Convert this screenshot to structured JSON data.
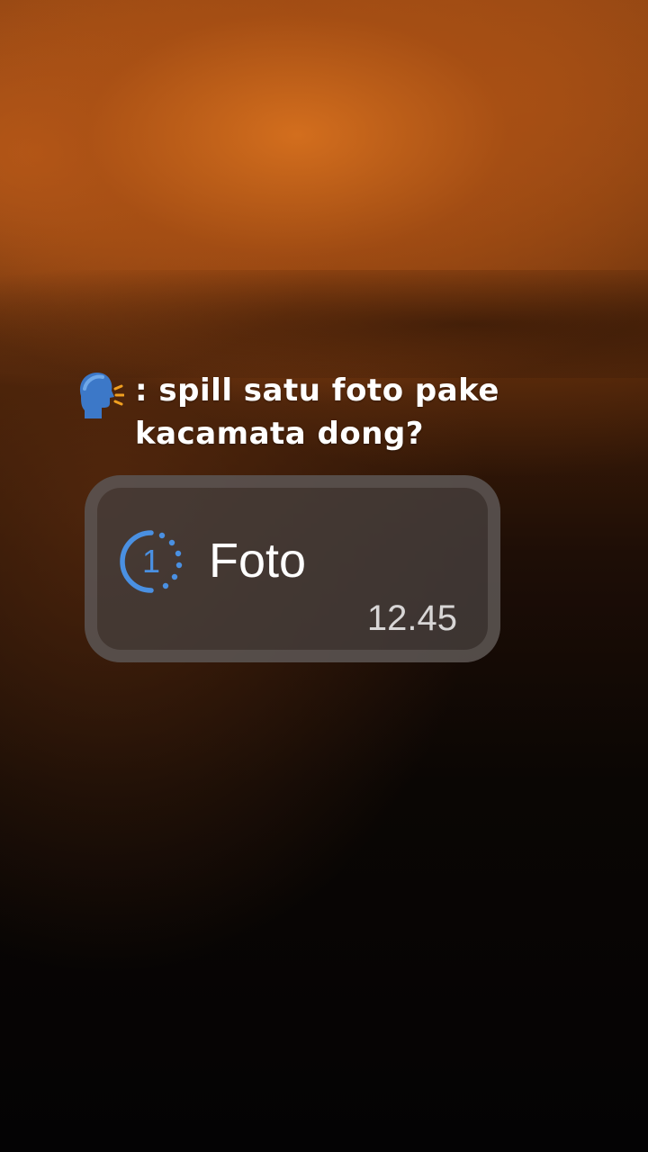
{
  "caption": {
    "speaker_icon": "speaking-head-icon",
    "text": ": spill satu foto pake\nkacamata dong?"
  },
  "message": {
    "icon": "view-once-icon",
    "view_once_count": "1",
    "label": "Foto",
    "time": "12.45",
    "accent_color": "#4a90e2"
  }
}
